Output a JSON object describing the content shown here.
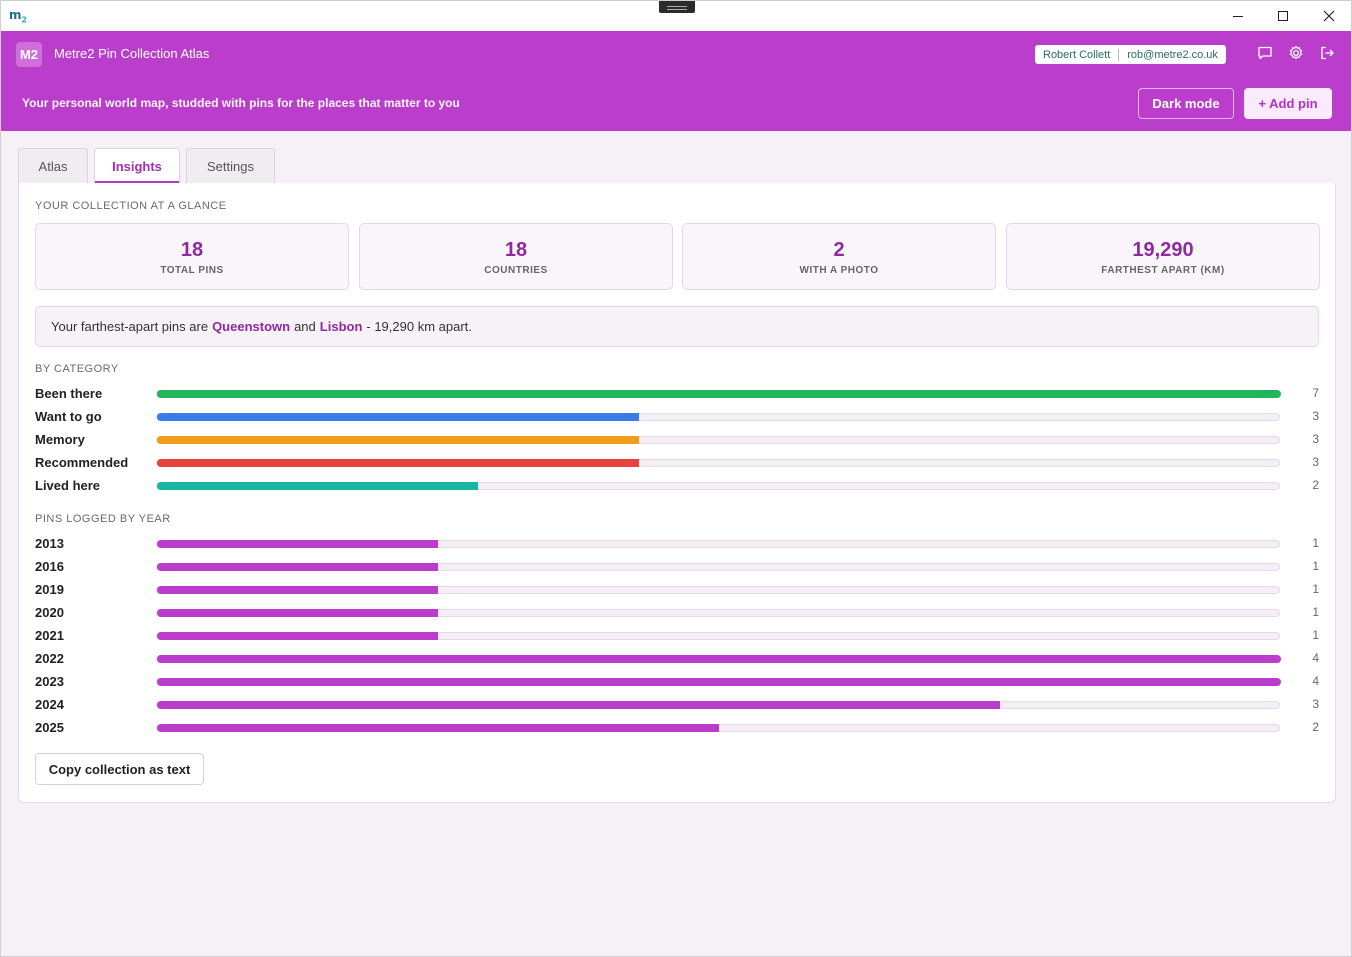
{
  "window": {
    "logo_text": "m",
    "logo_sub": "2"
  },
  "header": {
    "badge": "M2",
    "title": "Metre2 Pin Collection Atlas",
    "user_name": "Robert Collett",
    "user_email": "rob@metre2.co.uk",
    "tagline": "Your personal world map, studded with pins for the places that matter to you",
    "dark_mode_label": "Dark mode",
    "add_pin_label": "+ Add pin"
  },
  "tabs": [
    {
      "label": "Atlas"
    },
    {
      "label": "Insights"
    },
    {
      "label": "Settings"
    }
  ],
  "insights": {
    "glance_heading": "YOUR COLLECTION AT A GLANCE",
    "stats": [
      {
        "value": "18",
        "label": "TOTAL PINS"
      },
      {
        "value": "18",
        "label": "COUNTRIES"
      },
      {
        "value": "2",
        "label": "WITH A PHOTO"
      },
      {
        "value": "19,290",
        "label": "FARTHEST APART (KM)"
      }
    ],
    "farthest": {
      "prefix": "Your farthest-apart pins are",
      "place_a": "Queenstown",
      "joiner": "and",
      "place_b": "Lisbon",
      "suffix": "- 19,290 km apart."
    },
    "category_heading": "BY CATEGORY",
    "category_max": 7,
    "categories": [
      {
        "name": "Been there",
        "count": 7,
        "color": "#22b55a"
      },
      {
        "name": "Want to go",
        "count": 3,
        "color": "#3b7de8"
      },
      {
        "name": "Memory",
        "count": 3,
        "color": "#f39c1a"
      },
      {
        "name": "Recommended",
        "count": 3,
        "color": "#e8423c"
      },
      {
        "name": "Lived here",
        "count": 2,
        "color": "#17b5a2"
      }
    ],
    "year_heading": "PINS LOGGED BY YEAR",
    "year_max": 4,
    "year_color": "#bb3dcb",
    "years": [
      {
        "name": "2013",
        "count": 1
      },
      {
        "name": "2016",
        "count": 1
      },
      {
        "name": "2019",
        "count": 1
      },
      {
        "name": "2020",
        "count": 1
      },
      {
        "name": "2021",
        "count": 1
      },
      {
        "name": "2022",
        "count": 4
      },
      {
        "name": "2023",
        "count": 4
      },
      {
        "name": "2024",
        "count": 3
      },
      {
        "name": "2025",
        "count": 2
      }
    ],
    "copy_label": "Copy collection as text"
  }
}
